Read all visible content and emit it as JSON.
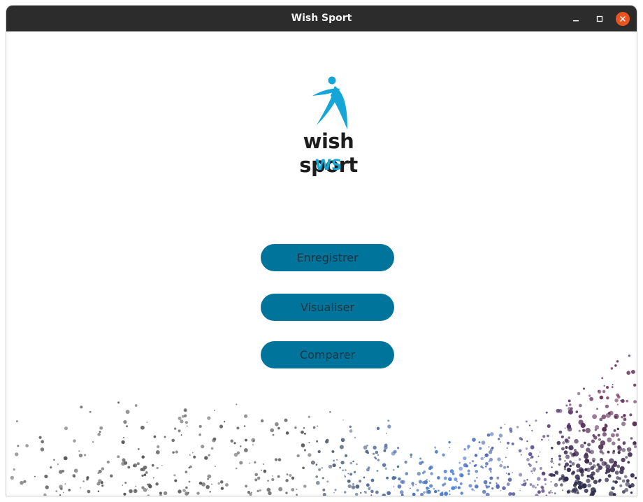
{
  "window": {
    "title": "Wish Sport",
    "controls": [
      "minimize-icon",
      "maximize-icon",
      "close-icon"
    ],
    "accent_close": "#e95420"
  },
  "logo": {
    "wordmark": "wish sport",
    "abbreviation": "WS",
    "icon": "running-figure-icon",
    "brand_color": "#14a6d6"
  },
  "menu": {
    "buttons": [
      {
        "label": "Enregistrer"
      },
      {
        "label": "Visualiser"
      },
      {
        "label": "Comparer"
      }
    ],
    "button_color": "#00749b"
  },
  "decoration": {
    "style": "particle-wave",
    "colors": [
      "#555555",
      "#4a7fd6",
      "#6b2f5a",
      "#2d2b4a"
    ]
  }
}
